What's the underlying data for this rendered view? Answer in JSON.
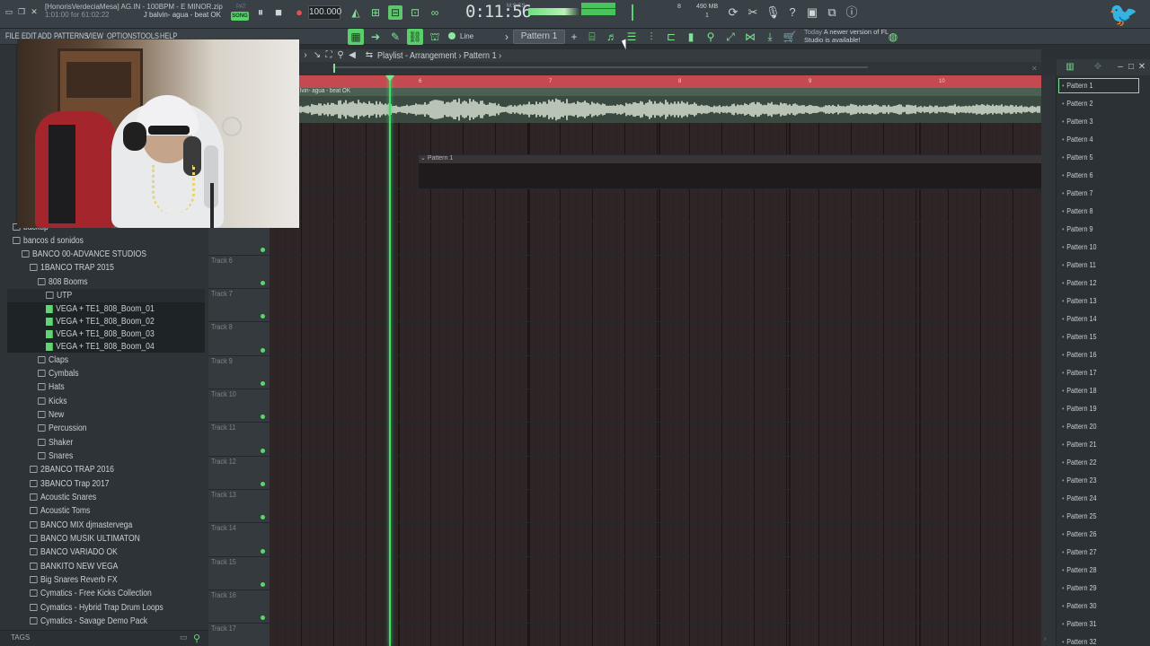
{
  "app": {
    "song_file": "[HonorisVerdeciaMesa] AG.IN - 100BPM - E MINOR.zip",
    "hint": "1:01:00 for 61:02:22",
    "song_title": "J balvin- agua - beat OK",
    "tempo": "100.000",
    "time": "0:11:56",
    "time_label": "M:S:CS",
    "cpu": "8",
    "memory": "490 MB",
    "polyphony": "1"
  },
  "menu": [
    "FILE",
    "EDIT",
    "ADD",
    "PATTERNS",
    "VIEW",
    "OPTIONS",
    "TOOLS",
    "HELP"
  ],
  "toolbar": {
    "snap": "Line",
    "pattern": "Pattern 1",
    "news_title": "Today",
    "news_text": "A newer version of FL Studio is available!"
  },
  "transport": {
    "mode_label": "PAT",
    "song_label": "SONG"
  },
  "playlist": {
    "title": "Playlist - Arrangement",
    "pattern": "Pattern 1",
    "bars": [
      "6",
      "7",
      "8",
      "9",
      "10"
    ],
    "audio_clip": "lvin- agua - beat OK",
    "pattern_clip": "Pattern 1",
    "tracks": [
      "Track 6",
      "Track 7",
      "Track 8",
      "Track 9",
      "Track 10",
      "Track 11",
      "Track 12",
      "Track 13",
      "Track 14",
      "Track 15",
      "Track 16",
      "Track 17"
    ]
  },
  "browser": {
    "items": [
      "backup",
      "bancos d sonidos",
      "BANCO 00-ADVANCE STUDIOS",
      "1BANCO TRAP 2015",
      "808 Booms",
      "UTP",
      "VEGA + TE1_808_Boom_01",
      "VEGA + TE1_808_Boom_02",
      "VEGA + TE1_808_Boom_03",
      "VEGA + TE1_808_Boom_04",
      "Claps",
      "Cymbals",
      "Hats",
      "Kicks",
      "New",
      "Percussion",
      "Shaker",
      "Snares",
      "2BANCO TRAP 2016",
      "3BANCO Trap 2017",
      "Acoustic Snares",
      "Acoustic Toms",
      "BANCO MIX djmastervega",
      "BANCO MUSIK ULTIMATON",
      "BANCO VARIADO OK",
      "BANKITO NEW VEGA",
      "Big Snares Reverb FX",
      "Cymatics - Free Kicks Collection",
      "Cymatics - Hybrid Trap Drum Loops",
      "Cymatics - Savage Demo Pack"
    ],
    "tags": "TAGS"
  },
  "patterns": [
    "Pattern 1",
    "Pattern 2",
    "Pattern 3",
    "Pattern 4",
    "Pattern 5",
    "Pattern 6",
    "Pattern 7",
    "Pattern 8",
    "Pattern 9",
    "Pattern 10",
    "Pattern 11",
    "Pattern 12",
    "Pattern 13",
    "Pattern 14",
    "Pattern 15",
    "Pattern 16",
    "Pattern 17",
    "Pattern 18",
    "Pattern 19",
    "Pattern 20",
    "Pattern 21",
    "Pattern 22",
    "Pattern 23",
    "Pattern 24",
    "Pattern 25",
    "Pattern 26",
    "Pattern 27",
    "Pattern 28",
    "Pattern 29",
    "Pattern 30",
    "Pattern 31",
    "Pattern 32"
  ],
  "colors": {
    "accent": "#5fd36f",
    "timeline": "#c44a4f",
    "playhead": "#3ee06a",
    "background": "#2b3034"
  }
}
